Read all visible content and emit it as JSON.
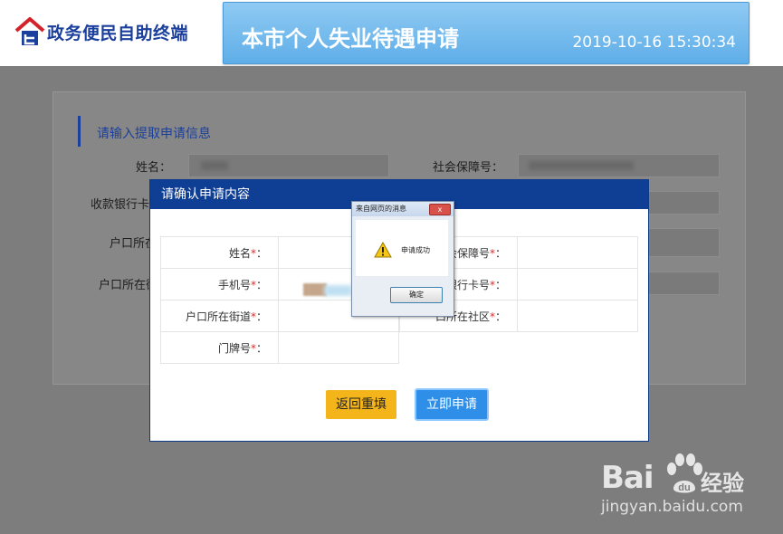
{
  "header": {
    "logo_text": "政务便民自助终端",
    "title": "本市个人失业待遇申请",
    "datetime": "2019-10-16 15:30:34"
  },
  "form": {
    "heading": "请输入提取申请信息",
    "fields": {
      "name_label": "姓名：",
      "ssn_label": "社会保障号：",
      "bank_label": "收款银行卡号",
      "hukou_label": "户口所在",
      "hukou2_label": "户口所在街"
    }
  },
  "modal": {
    "title": "请确认申请内容",
    "left_rows": [
      {
        "label": "姓名",
        "suffix": "："
      },
      {
        "label": "手机号",
        "suffix": "："
      },
      {
        "label": "户口所在街道",
        "suffix": "："
      },
      {
        "label": "门牌号",
        "suffix": "："
      }
    ],
    "right_rows": [
      {
        "label": "会保障号",
        "suffix": "："
      },
      {
        "label": "银行卡号",
        "suffix": "："
      },
      {
        "label": "口所在社区",
        "suffix": "："
      }
    ],
    "required_mark": "*",
    "back_button": "返回重填",
    "submit_button": "立即申请"
  },
  "alert": {
    "title": "来自网页的消息",
    "close": "x",
    "message": "申请成功",
    "ok": "确定",
    "icon": "warning-icon"
  },
  "watermark": {
    "brand": "Bai",
    "brand_tail": "经验",
    "url": "jingyan.baidu.com"
  },
  "colors": {
    "brand_blue": "#1b3f9c",
    "modal_header": "#0f3f94",
    "back_button": "#f4b51a",
    "submit_button": "#2f8fe8",
    "required": "#e12a2a"
  }
}
